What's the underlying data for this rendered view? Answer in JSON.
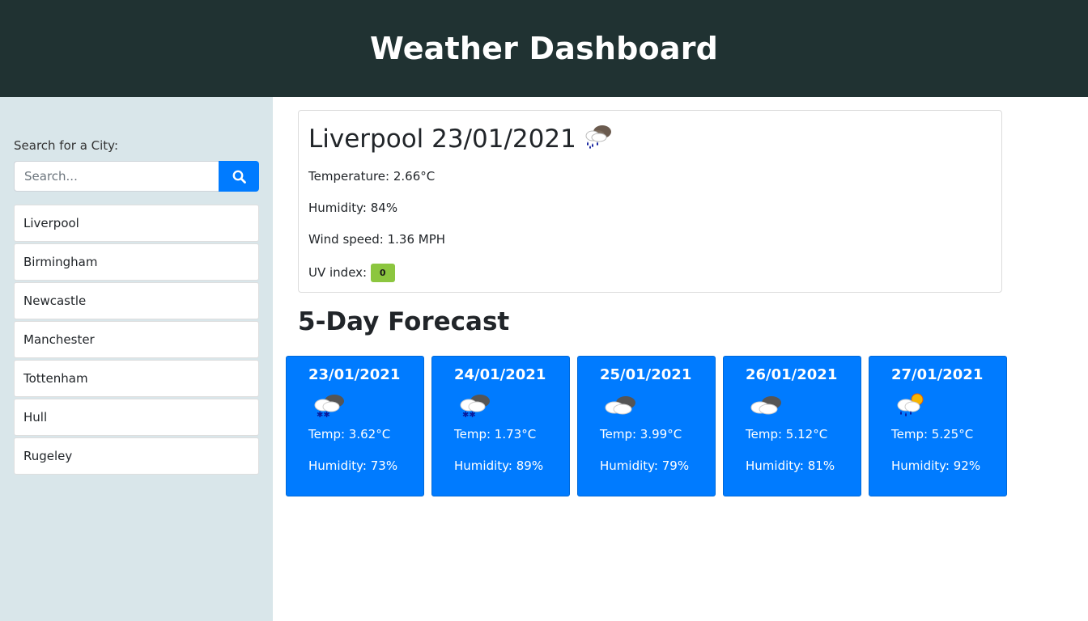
{
  "header": {
    "title": "Weather Dashboard"
  },
  "sidebar": {
    "search_label": "Search for a City:",
    "search_placeholder": "Search...",
    "search_value": "",
    "search_icon": "search-icon",
    "cities": [
      "Liverpool",
      "Birmingham",
      "Newcastle",
      "Manchester",
      "Tottenham",
      "Hull",
      "Rugeley"
    ]
  },
  "current": {
    "title": "Liverpool 23/01/2021",
    "icon": "rain-snow-icon",
    "temperature": "Temperature: 2.66°C",
    "humidity": "Humidity: 84%",
    "wind": "Wind speed: 1.36 MPH",
    "uv_label": "UV index:",
    "uv_value": "0",
    "uv_color": "#8cc63f"
  },
  "forecast": {
    "title": "5-Day Forecast",
    "days": [
      {
        "date": "23/01/2021",
        "icon": "snow-cloud-icon",
        "temp": "Temp: 3.62°C",
        "humidity": "Humidity: 73%"
      },
      {
        "date": "24/01/2021",
        "icon": "snow-cloud-icon",
        "temp": "Temp: 1.73°C",
        "humidity": "Humidity: 89%"
      },
      {
        "date": "25/01/2021",
        "icon": "cloud-icon",
        "temp": "Temp: 3.99°C",
        "humidity": "Humidity: 79%"
      },
      {
        "date": "26/01/2021",
        "icon": "cloud-icon",
        "temp": "Temp: 5.12°C",
        "humidity": "Humidity: 81%"
      },
      {
        "date": "27/01/2021",
        "icon": "sun-rain-icon",
        "temp": "Temp: 5.25°C",
        "humidity": "Humidity: 92%"
      }
    ]
  },
  "colors": {
    "header_bg": "#203232",
    "sidebar_bg": "#d9e6ea",
    "accent": "#007bff"
  }
}
